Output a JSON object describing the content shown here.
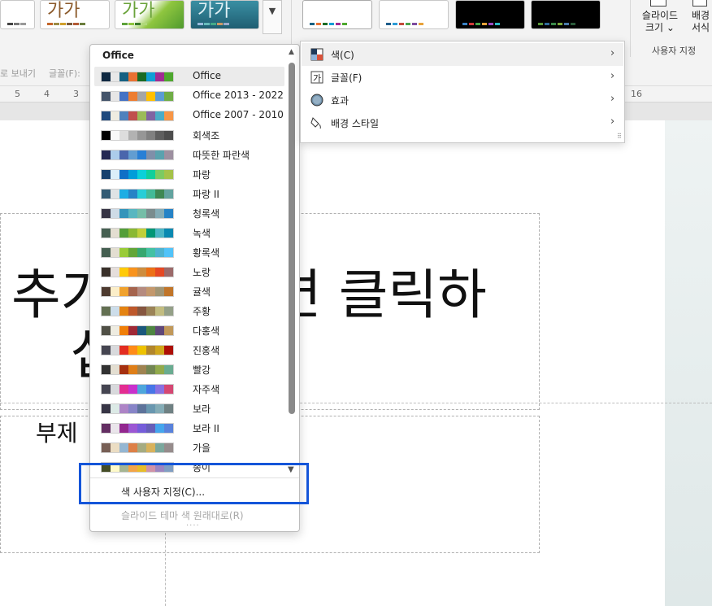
{
  "ribbon": {
    "variants_more_icon": "chevron-down-icon",
    "slide_size_label": "슬라이드 크기",
    "slide_size_line1": "슬라이드",
    "slide_size_line2": "크기 ⌄",
    "bg_format_line1": "배경",
    "bg_format_line2": "서식",
    "customize_group_label": "사용자 지정",
    "theme_thumb_text": "가가",
    "bar_left_label1": "로 보내기",
    "bar_left_label2": "글꼴(F):"
  },
  "ruler": {
    "left_ticks": [
      "5",
      "4",
      "3"
    ],
    "right_tick": "16"
  },
  "slide": {
    "title_visible": "추가",
    "title_visible_right": "면 클릭하",
    "title_line2": "십",
    "subtitle_visible": "부제"
  },
  "color_menu": {
    "header": "Office",
    "schemes": [
      {
        "name": "Office",
        "colors": [
          "#0e2841",
          "#e8e8e8",
          "#156082",
          "#e97132",
          "#196b24",
          "#0f9ed5",
          "#a02b93",
          "#4ea72e"
        ]
      },
      {
        "name": "Office 2013 - 2022",
        "colors": [
          "#44546a",
          "#e7e6e6",
          "#4472c4",
          "#ed7d31",
          "#a5a5a5",
          "#ffc000",
          "#5b9bd5",
          "#70ad47"
        ]
      },
      {
        "name": "Office 2007 - 2010",
        "colors": [
          "#1f497d",
          "#eeece1",
          "#4f81bd",
          "#c0504d",
          "#9bbb59",
          "#8064a2",
          "#4bacc6",
          "#f79646"
        ]
      },
      {
        "name": "회색조",
        "colors": [
          "#000000",
          "#f8f8f8",
          "#dddddd",
          "#b2b2b2",
          "#969696",
          "#808080",
          "#5f5f5f",
          "#4d4d4d"
        ]
      },
      {
        "name": "따뜻한 파란색",
        "colors": [
          "#242852",
          "#acccea",
          "#4a66ac",
          "#629dd1",
          "#297fd5",
          "#7f8fa9",
          "#5aa2ae",
          "#9d90a0"
        ]
      },
      {
        "name": "파랑",
        "colors": [
          "#17406d",
          "#dbeff9",
          "#0f6fc6",
          "#009dd9",
          "#0bd0d9",
          "#10cf9b",
          "#7cca62",
          "#a5c249"
        ]
      },
      {
        "name": "파랑 II",
        "colors": [
          "#335b74",
          "#dfe3e5",
          "#1cade4",
          "#2683c6",
          "#27ced7",
          "#42ba97",
          "#3e8853",
          "#62a39f"
        ]
      },
      {
        "name": "청록색",
        "colors": [
          "#373545",
          "#cedbe6",
          "#3494ba",
          "#58b6c0",
          "#75bda7",
          "#7a8c8e",
          "#84acb6",
          "#2683c6"
        ]
      },
      {
        "name": "녹색",
        "colors": [
          "#455f51",
          "#e3ded1",
          "#549e39",
          "#8ab833",
          "#c0cf3a",
          "#029676",
          "#4ab5c4",
          "#0989b1"
        ]
      },
      {
        "name": "황록색",
        "colors": [
          "#455f51",
          "#e3ded1",
          "#99cb38",
          "#63a537",
          "#37a76f",
          "#44c1a3",
          "#4eb3cf",
          "#51c3f9"
        ]
      },
      {
        "name": "노랑",
        "colors": [
          "#39302a",
          "#e5dedb",
          "#ffca08",
          "#f8931d",
          "#ce8d3e",
          "#ec7016",
          "#e64823",
          "#9c6a6a"
        ]
      },
      {
        "name": "귤색",
        "colors": [
          "#4e3b30",
          "#fbeec9",
          "#f0a22e",
          "#a5644e",
          "#b58b80",
          "#c3986d",
          "#a19574",
          "#c17529"
        ]
      },
      {
        "name": "주황",
        "colors": [
          "#637052",
          "#ccddea",
          "#e48312",
          "#bd582c",
          "#865640",
          "#9b8357",
          "#c2bc80",
          "#94a088"
        ]
      },
      {
        "name": "다홍색",
        "colors": [
          "#505046",
          "#eeece1",
          "#f07f09",
          "#9f2936",
          "#1b587c",
          "#4e8542",
          "#604878",
          "#c19859"
        ]
      },
      {
        "name": "진홍색",
        "colors": [
          "#454551",
          "#d8d9dc",
          "#e32d21",
          "#ff8b18",
          "#eec200",
          "#b2862c",
          "#d0a61c",
          "#ad0f05"
        ]
      },
      {
        "name": "빨강",
        "colors": [
          "#323232",
          "#e3ded1",
          "#a53010",
          "#de7e18",
          "#9f8351",
          "#728653",
          "#92aa4c",
          "#6aac91"
        ]
      },
      {
        "name": "자주색",
        "colors": [
          "#454551",
          "#d8d9dc",
          "#e32d91",
          "#c830cc",
          "#4ea6dc",
          "#4775e7",
          "#8971e1",
          "#d54773"
        ]
      },
      {
        "name": "보라",
        "colors": [
          "#373545",
          "#dceae6",
          "#ad84c6",
          "#8784c7",
          "#5d739a",
          "#6997af",
          "#84acb6",
          "#6f8183"
        ]
      },
      {
        "name": "보라 II",
        "colors": [
          "#632e62",
          "#eae5eb",
          "#92278f",
          "#9b57d3",
          "#755dd9",
          "#665eb8",
          "#45a5ed",
          "#5982db"
        ]
      },
      {
        "name": "가을",
        "colors": [
          "#775f55",
          "#ebddc3",
          "#94b6d2",
          "#dd8047",
          "#a5ab81",
          "#d8b25c",
          "#7ba79d",
          "#968c8c"
        ]
      },
      {
        "name": "종이",
        "colors": [
          "#444d26",
          "#fefac9",
          "#a5b592",
          "#f3a447",
          "#e7bc29",
          "#d092a7",
          "#9c85c0",
          "#809ec2"
        ]
      }
    ],
    "customize_label": "색 사용자 지정(C)...",
    "reset_label": "슬라이드 테마 색 원래대로(R)"
  },
  "submenu": {
    "items": [
      {
        "label": "색(C)",
        "icon": "color-palette-icon"
      },
      {
        "label": "글꼴(F)",
        "icon": "font-icon"
      },
      {
        "label": "효과",
        "icon": "effects-icon"
      },
      {
        "label": "배경 스타일",
        "icon": "background-styles-icon"
      }
    ]
  },
  "colors": {
    "highlight": "#1455d9"
  }
}
